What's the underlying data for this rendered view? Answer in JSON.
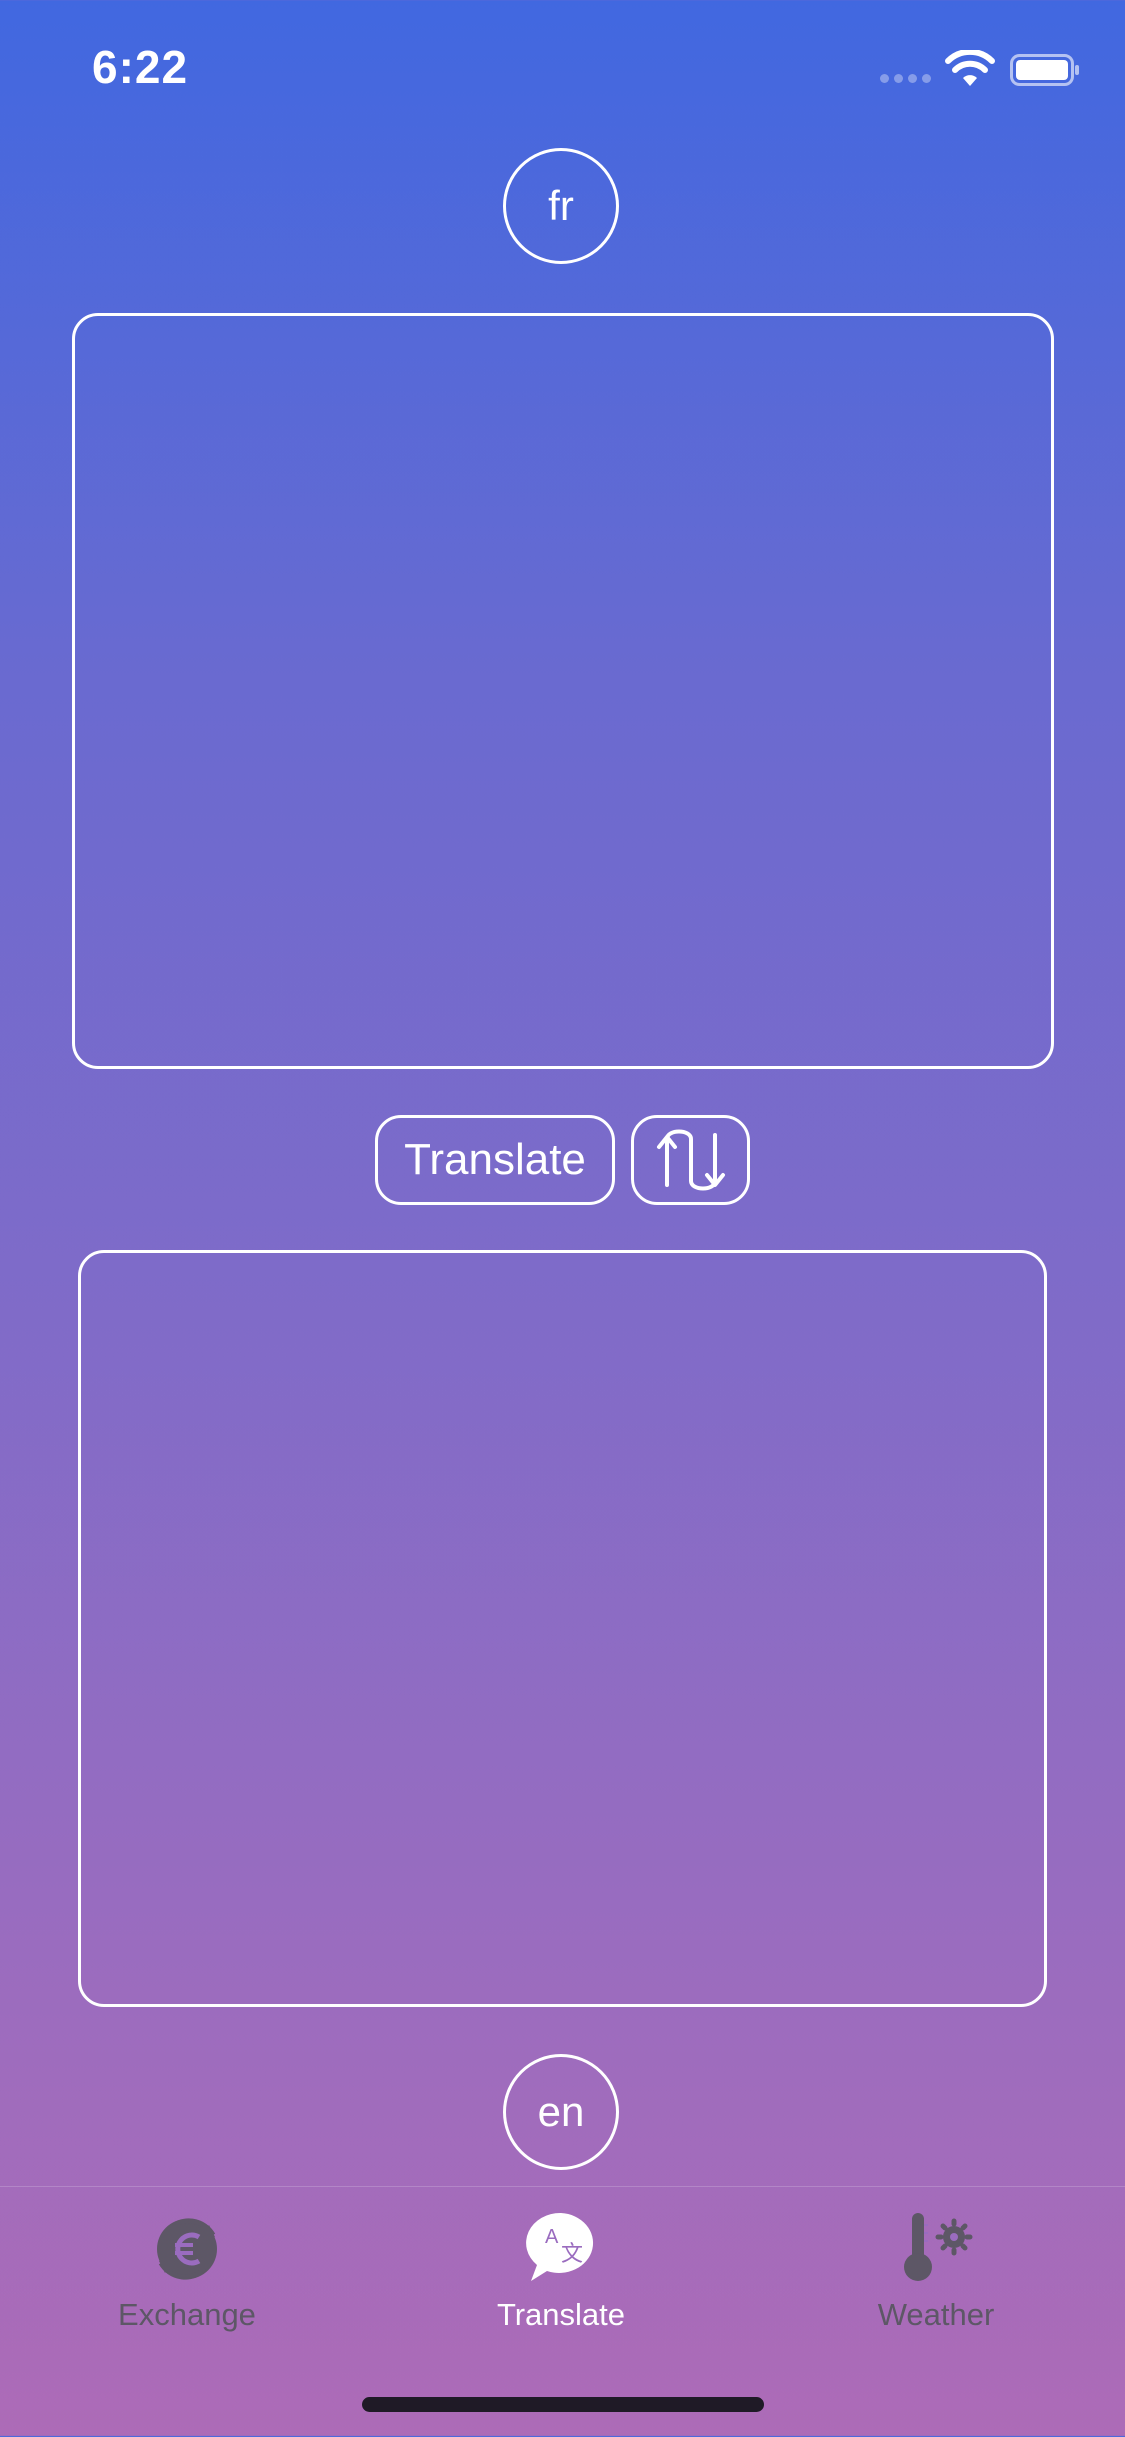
{
  "status_bar": {
    "time": "6:22"
  },
  "languages": {
    "source": "fr",
    "target": "en"
  },
  "source_box": {
    "value": ""
  },
  "target_box": {
    "value": ""
  },
  "actions": {
    "translate_label": "Translate",
    "swap_icon": "swap-arrows-icon"
  },
  "tab_bar": {
    "tabs": [
      {
        "label": "Exchange",
        "icon": "euro-exchange-icon",
        "active": false
      },
      {
        "label": "Translate",
        "icon": "translate-bubble-icon",
        "active": true
      },
      {
        "label": "Weather",
        "icon": "thermometer-gear-icon",
        "active": false
      }
    ]
  },
  "colors": {
    "gradient_top": "#4168e0",
    "gradient_bottom": "#ad6bb7",
    "tab_inactive": "#5d5766",
    "tab_active": "#ffffff"
  }
}
